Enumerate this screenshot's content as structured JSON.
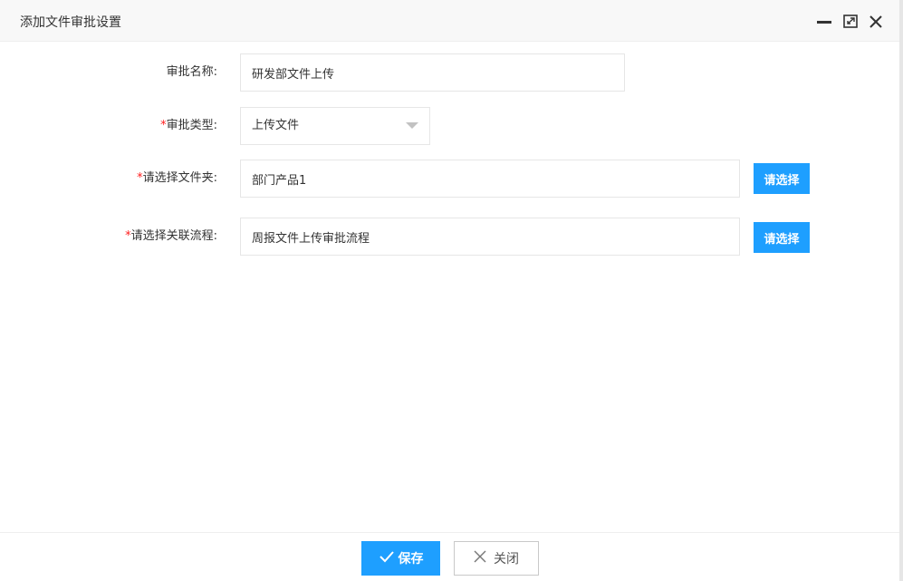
{
  "dialog": {
    "title": "添加文件审批设置",
    "controls": {
      "minimize_icon": "minimize-icon",
      "maximize_icon": "maximize-icon",
      "close_icon": "close-icon"
    }
  },
  "form": {
    "name": {
      "label": "审批名称:",
      "required": false,
      "value": "研发部文件上传"
    },
    "type": {
      "star": "*",
      "label": "审批类型:",
      "required": true,
      "value": "上传文件"
    },
    "folder": {
      "star": "*",
      "label": "请选择文件夹:",
      "required": true,
      "value": "部门产品1",
      "button": "请选择"
    },
    "flow": {
      "star": "*",
      "label": "请选择关联流程:",
      "required": true,
      "value": "周报文件上传审批流程",
      "button": "请选择"
    }
  },
  "footer": {
    "save_label": "保存",
    "save_icon": "check-icon",
    "close_label": "关闭",
    "close_icon": "x-icon"
  },
  "colors": {
    "primary": "#1e9fff",
    "required_star": "#ff1e1e",
    "border": "#e6e6e6",
    "titlebar_bg": "#f8f8f8"
  }
}
